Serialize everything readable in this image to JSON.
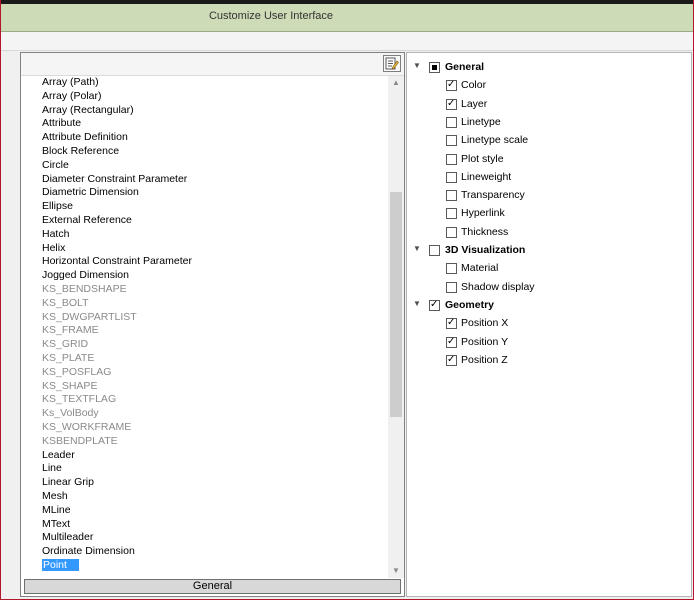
{
  "window": {
    "title": "Customize User Interface"
  },
  "object_list": {
    "items": [
      {
        "label": "Array (Path)",
        "dim": false
      },
      {
        "label": "Array (Polar)",
        "dim": false
      },
      {
        "label": "Array (Rectangular)",
        "dim": false
      },
      {
        "label": "Attribute",
        "dim": false
      },
      {
        "label": "Attribute Definition",
        "dim": false
      },
      {
        "label": "Block Reference",
        "dim": false
      },
      {
        "label": "Circle",
        "dim": false
      },
      {
        "label": "Diameter Constraint Parameter",
        "dim": false
      },
      {
        "label": "Diametric Dimension",
        "dim": false
      },
      {
        "label": "Ellipse",
        "dim": false
      },
      {
        "label": "External Reference",
        "dim": false
      },
      {
        "label": "Hatch",
        "dim": false
      },
      {
        "label": "Helix",
        "dim": false
      },
      {
        "label": "Horizontal Constraint Parameter",
        "dim": false
      },
      {
        "label": "Jogged Dimension",
        "dim": false
      },
      {
        "label": "KS_BENDSHAPE",
        "dim": true
      },
      {
        "label": "KS_BOLT",
        "dim": true
      },
      {
        "label": "KS_DWGPARTLIST",
        "dim": true
      },
      {
        "label": "KS_FRAME",
        "dim": true
      },
      {
        "label": "KS_GRID",
        "dim": true
      },
      {
        "label": "KS_PLATE",
        "dim": true
      },
      {
        "label": "KS_POSFLAG",
        "dim": true
      },
      {
        "label": "KS_SHAPE",
        "dim": true
      },
      {
        "label": "KS_TEXTFLAG",
        "dim": true
      },
      {
        "label": "Ks_VolBody",
        "dim": true
      },
      {
        "label": "KS_WORKFRAME",
        "dim": true
      },
      {
        "label": "KSBENDPLATE",
        "dim": true
      },
      {
        "label": "Leader",
        "dim": false
      },
      {
        "label": "Line",
        "dim": false
      },
      {
        "label": "Linear Grip",
        "dim": false
      },
      {
        "label": "Mesh",
        "dim": false
      },
      {
        "label": "MLine",
        "dim": false
      },
      {
        "label": "MText",
        "dim": false
      },
      {
        "label": "Multileader",
        "dim": false
      },
      {
        "label": "Ordinate Dimension",
        "dim": false
      },
      {
        "label": "Point",
        "dim": false,
        "selected": true
      }
    ],
    "scroll_fraction": 0.41,
    "footer_button": "General"
  },
  "properties": {
    "categories": [
      {
        "label": "General",
        "state": "indeterminate",
        "items": [
          {
            "label": "Color",
            "checked": true
          },
          {
            "label": "Layer",
            "checked": true
          },
          {
            "label": "Linetype",
            "checked": false
          },
          {
            "label": "Linetype scale",
            "checked": false
          },
          {
            "label": "Plot style",
            "checked": false
          },
          {
            "label": "Lineweight",
            "checked": false
          },
          {
            "label": "Transparency",
            "checked": false
          },
          {
            "label": "Hyperlink",
            "checked": false
          },
          {
            "label": "Thickness",
            "checked": false
          }
        ]
      },
      {
        "label": "3D Visualization",
        "state": "unchecked",
        "items": [
          {
            "label": "Material",
            "checked": false
          },
          {
            "label": "Shadow display",
            "checked": false
          }
        ]
      },
      {
        "label": "Geometry",
        "state": "checked",
        "items": [
          {
            "label": "Position X",
            "checked": true
          },
          {
            "label": "Position Y",
            "checked": true
          },
          {
            "label": "Position Z",
            "checked": true
          }
        ]
      }
    ]
  },
  "icons": {
    "edit": "edit-list-icon",
    "expand": "chevron-down-icon",
    "scroll_up": "scroll-up-arrow-icon",
    "scroll_down": "scroll-down-arrow-icon"
  },
  "colors": {
    "title_bar": "#cddbb7",
    "selection": "#3399ff",
    "border_accent": "#b2172b"
  }
}
